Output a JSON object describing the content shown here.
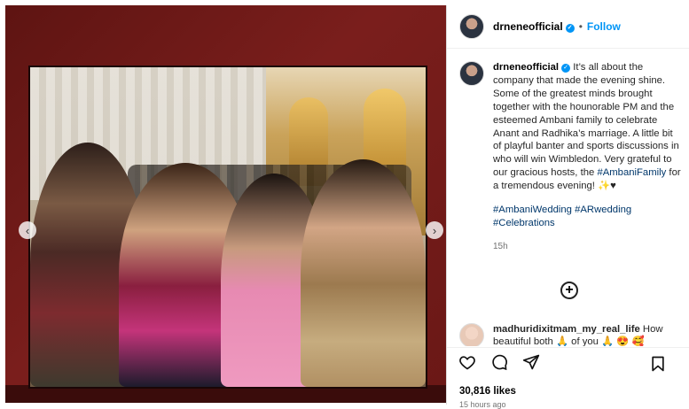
{
  "post": {
    "username": "drneneofficial",
    "follow_label": "Follow",
    "separator": "•",
    "caption_user": "drneneofficial",
    "caption_text": " It’s all about the company that made the evening shine. Some of the greatest minds brought together with the hounorable PM and the esteemed Ambani family to celebrate Anant and Radhika’s marriage. A little bit of playful banter and sports discussions in who will win Wimbledon. Very grateful to our gracious hosts, the ",
    "caption_hashtag": "#AmbaniFamily",
    "caption_end": " for a tremendous evening! ✨♥",
    "hashtags": "#AmbaniWedding #ARwedding #Celebrations",
    "time": "15h",
    "load_more": "+",
    "comment_user": "madhuridixitmam_my_real_life",
    "comment_text": " How beautiful both 🙏 of you 🙏 😍 🥰",
    "likes": "30,816 likes",
    "posted_ago": "15 hours ago"
  },
  "icons": {
    "verified": "verified-badge-icon",
    "like": "heart-icon",
    "comment": "comment-icon",
    "share": "share-icon",
    "save": "bookmark-icon",
    "prev": "chevron-left-icon",
    "next": "chevron-right-icon"
  },
  "colors": {
    "accent": "#0095f6",
    "media_background": "#6a1816"
  }
}
